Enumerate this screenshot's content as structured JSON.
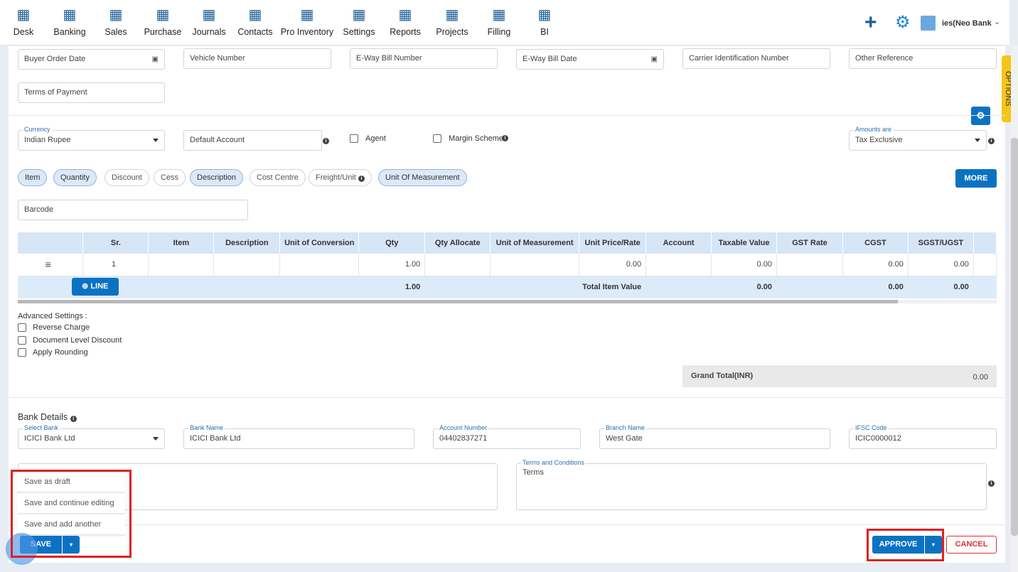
{
  "nav": {
    "items": [
      {
        "label": "Desk",
        "icon": "desk-icon"
      },
      {
        "label": "Banking",
        "icon": "bank-icon"
      },
      {
        "label": "Sales",
        "icon": "sales-icon"
      },
      {
        "label": "Purchase",
        "icon": "purchase-icon"
      },
      {
        "label": "Journals",
        "icon": "journals-icon"
      },
      {
        "label": "Contacts",
        "icon": "contacts-icon"
      },
      {
        "label": "Pro Inventory",
        "icon": "inventory-icon"
      },
      {
        "label": "Settings",
        "icon": "settings-icon"
      },
      {
        "label": "Reports",
        "icon": "reports-icon"
      },
      {
        "label": "Projects",
        "icon": "projects-icon"
      },
      {
        "label": "Filling",
        "icon": "filling-icon"
      },
      {
        "label": "BI",
        "icon": "bi-icon"
      }
    ],
    "company": "ies(Neo Bank"
  },
  "fields": {
    "buyer_order_date": "Buyer Order Date",
    "vehicle_number": "Vehicle Number",
    "eway_bill_number": "E-Way Bill Number",
    "eway_bill_date": "E-Way Bill Date",
    "carrier_id": "Carrier Identification Number",
    "other_reference": "Other Reference",
    "terms_of_payment": "Terms of Payment"
  },
  "options_tab": "OPTIONS",
  "currency": {
    "label": "Currency",
    "value": "Indian Rupee"
  },
  "default_account": "Default Account",
  "agent": "Agent",
  "margin_scheme": "Margin Scheme",
  "amounts_are": {
    "label": "Amounts are",
    "value": "Tax Exclusive"
  },
  "pills": [
    {
      "label": "Item",
      "on": true
    },
    {
      "label": "Quantity",
      "on": true
    },
    {
      "label": "Discount",
      "on": false
    },
    {
      "label": "Cess",
      "on": false
    },
    {
      "label": "Description",
      "on": true
    },
    {
      "label": "Cost Centre",
      "on": false
    },
    {
      "label": "Freight/Unit",
      "on": false
    },
    {
      "label": "Unit Of Measurement",
      "on": true
    }
  ],
  "more_button": "MORE",
  "barcode": "Barcode",
  "table": {
    "headers": [
      "",
      "Sr.",
      "Item",
      "Description",
      "Unit of Conversion",
      "Qty",
      "Qty Allocate",
      "Unit of Measurement",
      "Unit Price/Rate",
      "Account",
      "Taxable Value",
      "GST Rate",
      "CGST",
      "SGST/UGST",
      ""
    ],
    "row": [
      "",
      "1",
      "",
      "",
      "",
      "1.00",
      "",
      "",
      "0.00",
      "",
      "0.00",
      "",
      "0.00",
      "0.00",
      ""
    ],
    "line_button": "LINE",
    "total_qty": "1.00",
    "total_label": "Total Item Value",
    "total_taxable": "0.00",
    "total_cgst": "0.00",
    "total_sgst": "0.00"
  },
  "advanced": {
    "title": "Advanced Settings :",
    "options": [
      "Reverse Charge",
      "Document Level Discount",
      "Apply Rounding"
    ]
  },
  "grand_total": {
    "label": "Grand Total(INR)",
    "value": "0.00"
  },
  "bank": {
    "title": "Bank Details",
    "select_bank": {
      "label": "Select Bank",
      "value": "ICICI Bank Ltd"
    },
    "bank_name": {
      "label": "Bank Name",
      "value": "ICICI Bank Ltd"
    },
    "account_number": {
      "label": "Account Number",
      "value": "04402837271"
    },
    "branch_name": {
      "label": "Branch Name",
      "value": "West Gate"
    },
    "ifsc": {
      "label": "IFSC Code",
      "value": "ICIC0000012"
    }
  },
  "terms": {
    "label": "Terms and Conditions",
    "value": "Terms"
  },
  "save_menu": [
    "Save as draft",
    "Save and continue editing",
    "Save and add another"
  ],
  "save_button": "SAVE",
  "approve_button": "APPROVE",
  "cancel_button": "CANCEL",
  "colors": {
    "primary": "#0b72c2",
    "highlight": "#e02020",
    "options_tab": "#f5c518"
  }
}
